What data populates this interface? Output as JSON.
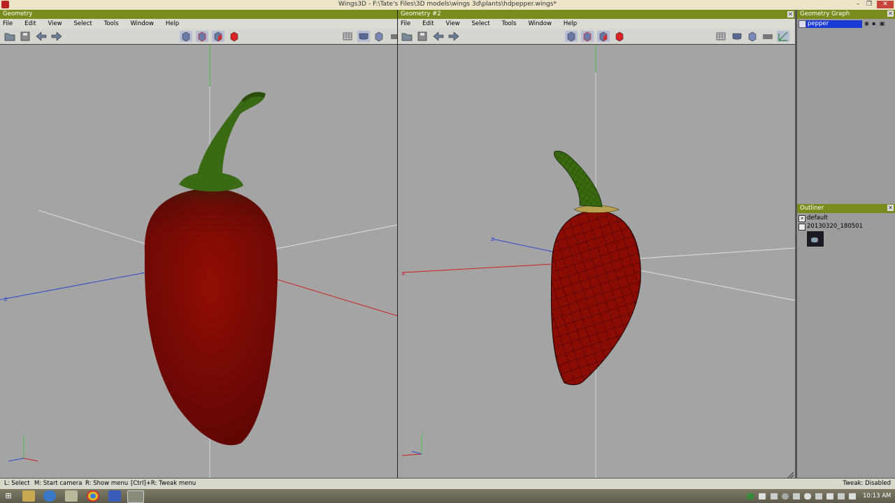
{
  "window": {
    "title": "Wings3D - F:\\Tate's Files\\3D models\\wings 3d\\plants\\hdpepper.wings*",
    "minimize": "–",
    "restore": "❐",
    "close": "✕"
  },
  "left_pane": {
    "title": "Geometry",
    "menu": [
      "File",
      "Edit",
      "View",
      "Select",
      "Tools",
      "Window",
      "Help"
    ],
    "axis_label": "z"
  },
  "right_pane": {
    "title": "Geometry #2",
    "menu": [
      "File",
      "Edit",
      "View",
      "Select",
      "Tools",
      "Window",
      "Help"
    ],
    "axis_z": "z",
    "axis_x": "x"
  },
  "geometry_graph": {
    "title": "Geometry Graph",
    "items": [
      {
        "label": "pepper"
      }
    ]
  },
  "outliner": {
    "title": "Outliner",
    "items": [
      {
        "label": "default"
      },
      {
        "label": "20130320_180501"
      }
    ]
  },
  "status": {
    "hints": [
      "L: Select",
      "M: Start camera",
      "R: Show menu",
      "[Ctrl]+R: Tweak menu"
    ],
    "tweak": "Tweak: Disabled"
  },
  "taskbar": {
    "clock": "10:13 AM"
  },
  "colors": {
    "panel_title_green": "#7a8a1c",
    "pepper_red": "#8a0c04",
    "stem_green": "#3a6a10",
    "selected_blue": "#1a3ad8"
  }
}
